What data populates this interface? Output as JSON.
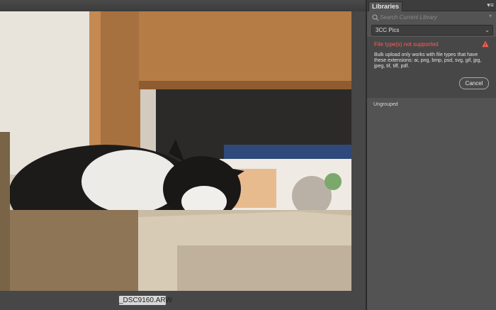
{
  "panel": {
    "tab_label": "Libraries",
    "menu_icon": "▾≡",
    "search_placeholder": "Search Current Library",
    "library_select": "3CC Pics",
    "alert": {
      "title": "File type(s) not supported",
      "message": "Bulk upload only works with file types that have these extensions: ai, png, bmp, psd, svg, gif, jpg, jpeg, tif, tiff, pdf.",
      "cancel_label": "Cancel"
    },
    "group_label": "Ungrouped"
  },
  "viewer": {
    "filename": "_DSC9160.ARW"
  },
  "colors": {
    "alert_title": "#ff5c50",
    "panel_bg": "#535353",
    "app_bg": "#3a3a3a"
  },
  "icons": [
    "search-icon",
    "chevron-down-icon",
    "warning-icon",
    "panel-menu-icon"
  ]
}
